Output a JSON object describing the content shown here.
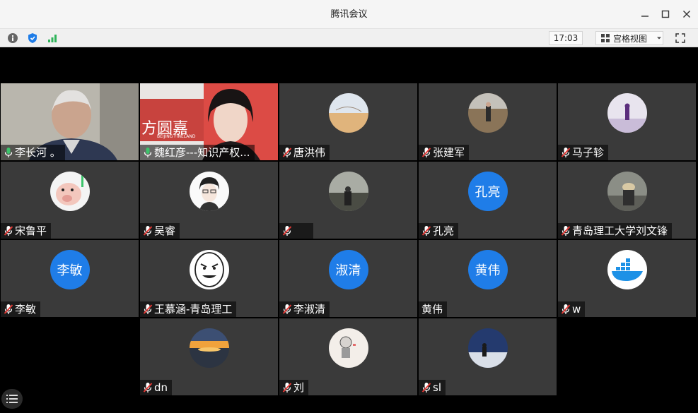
{
  "window": {
    "title": "腾讯会议",
    "controls": [
      "minimize-icon",
      "maximize-icon",
      "close-icon"
    ]
  },
  "toolbar": {
    "time": "17:03",
    "view_label": "宫格视图",
    "icons": [
      "info-icon",
      "shield-icon",
      "signal-icon",
      "fullscreen-icon"
    ]
  },
  "participants": [
    {
      "name": "李长河 。",
      "type": "video",
      "active": true,
      "mic": "on"
    },
    {
      "name": "魏红彦---知识产权...",
      "type": "video",
      "mic": "on",
      "video_text": "方圆嘉",
      "video_subtext": "BEIJING FINELAND"
    },
    {
      "name": "唐洪伟",
      "type": "avatar",
      "mic": "muted",
      "icon": "desert-photo-avatar"
    },
    {
      "name": "张建军",
      "type": "avatar",
      "mic": "muted",
      "icon": "outdoor-person-avatar"
    },
    {
      "name": "马子轸",
      "type": "avatar",
      "mic": "muted",
      "icon": "purple-silhouette-avatar"
    },
    {
      "name": "宋鲁平",
      "type": "avatar",
      "mic": "muted",
      "icon": "piglet-avatar"
    },
    {
      "name": "吴睿",
      "type": "avatar",
      "mic": "muted",
      "icon": "anime-boy-avatar"
    },
    {
      "name": "",
      "type": "avatar",
      "mic": "muted",
      "icon": "dark-landscape-avatar"
    },
    {
      "name": "孔亮",
      "type": "initials",
      "initials": "孔亮",
      "mic": "muted"
    },
    {
      "name": "青岛理工大学刘文锋",
      "type": "avatar",
      "mic": "muted",
      "icon": "person-hat-avatar"
    },
    {
      "name": "李敏",
      "type": "initials",
      "initials": "李敏",
      "mic": "muted"
    },
    {
      "name": "王慕涵-青岛理工",
      "type": "avatar",
      "mic": "muted",
      "icon": "meme-face-avatar"
    },
    {
      "name": "李淑清",
      "type": "initials",
      "initials": "淑清",
      "mic": "muted"
    },
    {
      "name": "黄伟",
      "type": "initials",
      "initials": "黄伟",
      "mic": "none"
    },
    {
      "name": "w",
      "type": "avatar",
      "mic": "muted",
      "icon": "docker-whale-avatar"
    },
    {
      "name": "dn",
      "type": "avatar",
      "mic": "muted",
      "icon": "sunset-avatar"
    },
    {
      "name": "刘",
      "type": "avatar",
      "mic": "muted",
      "icon": "cartoon-child-avatar"
    },
    {
      "name": "sl",
      "type": "avatar",
      "mic": "muted",
      "icon": "night-sky-avatar"
    }
  ],
  "colors": {
    "tile_bg": "#3a3a3a",
    "active_border": "#3cc46b",
    "initials_bg": "#1f7de8",
    "mic_on": "#3cc46b",
    "mic_muted": "#e53935"
  }
}
